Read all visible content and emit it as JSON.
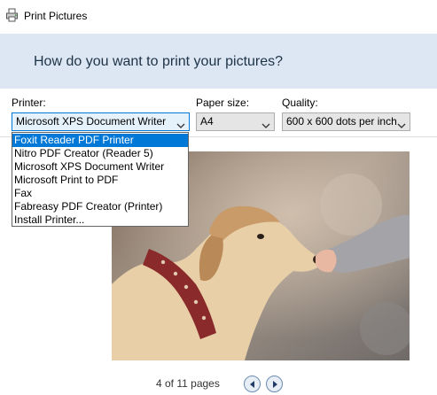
{
  "window": {
    "title": "Print Pictures",
    "icon": "printer-icon"
  },
  "header": {
    "question": "How do you want to print your pictures?"
  },
  "printer": {
    "label": "Printer:",
    "selected": "Microsoft XPS Document Writer",
    "options": [
      "Foxit Reader PDF Printer",
      "Nitro PDF Creator (Reader 5)",
      "Microsoft XPS Document Writer",
      "Microsoft Print to PDF",
      "Fax",
      "Fabreasy PDF Creator (Printer)",
      "Install Printer..."
    ],
    "highlighted_option": "Foxit Reader PDF Printer"
  },
  "paper_size": {
    "label": "Paper size:",
    "selected": "A4"
  },
  "quality": {
    "label": "Quality:",
    "selected": "600 x 600 dots per inch"
  },
  "preview": {
    "image": "dog-and-child-hand-photo",
    "page_current": 4,
    "page_total": 11,
    "pager_text": "4 of 11 pages"
  },
  "colors": {
    "header_bg": "#dce7f3",
    "selection": "#0078d7",
    "accent": "#0078d7"
  }
}
